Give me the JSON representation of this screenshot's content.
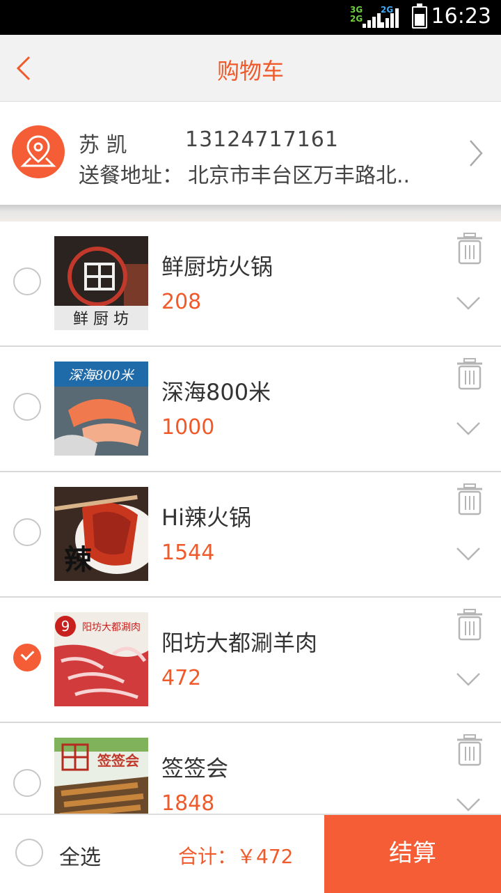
{
  "status": {
    "net_top": "3G",
    "net_bottom": "2G",
    "net_top2": "2G",
    "time": "16:23"
  },
  "header": {
    "title": "购物车"
  },
  "address": {
    "name": "苏 凯",
    "phone": "13124717161",
    "label": "送餐地址：",
    "text": "北京市丰台区万丰路北.."
  },
  "items": [
    {
      "name": "鲜厨坊火锅",
      "price": "208",
      "checked": false,
      "logo": "鲜 厨 坊"
    },
    {
      "name": "深海800米",
      "price": "1000",
      "checked": false,
      "logo": "深海800米"
    },
    {
      "name": "Hi辣火锅",
      "price": "1544",
      "checked": false,
      "logo": "辣"
    },
    {
      "name": "阳坊大都涮羊肉",
      "price": "472",
      "checked": true,
      "logo": "阳坊大都涮肉"
    },
    {
      "name": "签签会",
      "price": "1848",
      "checked": false,
      "logo": "签签会"
    }
  ],
  "footer": {
    "select_all": "全选",
    "total": "合计：￥472",
    "checkout": "结算"
  },
  "colors": {
    "accent": "#f45d35",
    "price": "#f05a2a"
  }
}
